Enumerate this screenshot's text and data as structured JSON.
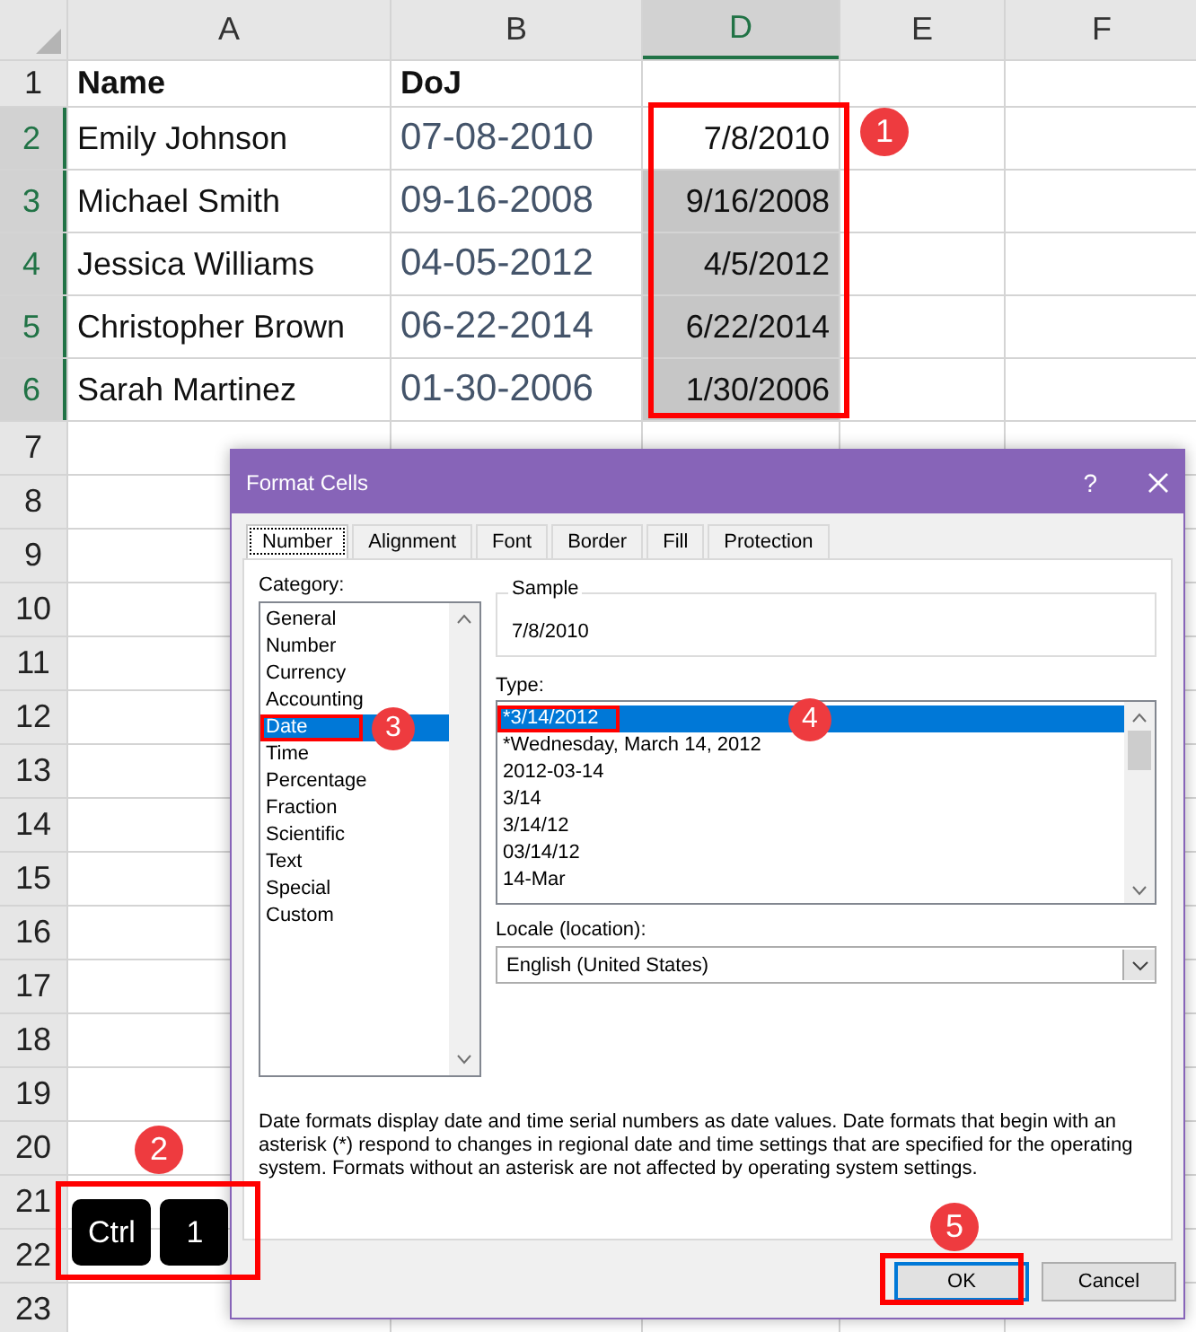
{
  "sheet": {
    "columns": [
      {
        "label": "A",
        "selected": false
      },
      {
        "label": "B",
        "selected": false
      },
      {
        "label": "D",
        "selected": true
      },
      {
        "label": "E",
        "selected": false
      },
      {
        "label": "F",
        "selected": false
      }
    ],
    "rows": [
      {
        "number": "1",
        "kind": "header",
        "selected": false,
        "name": "Name",
        "doj": "DoJ"
      },
      {
        "number": "2",
        "kind": "data",
        "selected": true,
        "active": true,
        "name": "Emily Johnson",
        "doj": "07-08-2010",
        "converted": "7/8/2010"
      },
      {
        "number": "3",
        "kind": "data",
        "selected": true,
        "active": false,
        "name": "Michael Smith",
        "doj": "09-16-2008",
        "converted": "9/16/2008"
      },
      {
        "number": "4",
        "kind": "data",
        "selected": true,
        "active": false,
        "name": "Jessica Williams",
        "doj": "04-05-2012",
        "converted": "4/5/2012"
      },
      {
        "number": "5",
        "kind": "data",
        "selected": true,
        "active": false,
        "name": "Christopher Brown",
        "doj": "06-22-2014",
        "converted": "6/22/2014"
      },
      {
        "number": "6",
        "kind": "data",
        "selected": true,
        "active": false,
        "name": "Sarah Martinez",
        "doj": "01-30-2006",
        "converted": "1/30/2006"
      },
      {
        "number": "7",
        "kind": "empty",
        "selected": false
      },
      {
        "number": "8",
        "kind": "empty",
        "selected": false
      },
      {
        "number": "9",
        "kind": "empty",
        "selected": false
      },
      {
        "number": "10",
        "kind": "empty",
        "selected": false
      },
      {
        "number": "11",
        "kind": "empty",
        "selected": false
      },
      {
        "number": "12",
        "kind": "empty",
        "selected": false
      },
      {
        "number": "13",
        "kind": "empty",
        "selected": false
      },
      {
        "number": "14",
        "kind": "empty",
        "selected": false
      },
      {
        "number": "15",
        "kind": "empty",
        "selected": false
      },
      {
        "number": "16",
        "kind": "empty",
        "selected": false
      },
      {
        "number": "17",
        "kind": "empty",
        "selected": false
      },
      {
        "number": "18",
        "kind": "empty",
        "selected": false
      },
      {
        "number": "19",
        "kind": "empty",
        "selected": false
      },
      {
        "number": "20",
        "kind": "empty",
        "selected": false
      },
      {
        "number": "21",
        "kind": "empty",
        "selected": false
      },
      {
        "number": "22",
        "kind": "empty",
        "selected": false
      },
      {
        "number": "23",
        "kind": "empty",
        "selected": false
      }
    ]
  },
  "dialog": {
    "title": "Format Cells",
    "help": "?",
    "tabs": [
      {
        "label": "Number",
        "selected": true
      },
      {
        "label": "Alignment",
        "selected": false
      },
      {
        "label": "Font",
        "selected": false
      },
      {
        "label": "Border",
        "selected": false
      },
      {
        "label": "Fill",
        "selected": false
      },
      {
        "label": "Protection",
        "selected": false
      }
    ],
    "category_label": "Category:",
    "categories": [
      {
        "label": "General",
        "selected": false
      },
      {
        "label": "Number",
        "selected": false
      },
      {
        "label": "Currency",
        "selected": false
      },
      {
        "label": "Accounting",
        "selected": false
      },
      {
        "label": "Date",
        "selected": true
      },
      {
        "label": "Time",
        "selected": false
      },
      {
        "label": "Percentage",
        "selected": false
      },
      {
        "label": "Fraction",
        "selected": false
      },
      {
        "label": "Scientific",
        "selected": false
      },
      {
        "label": "Text",
        "selected": false
      },
      {
        "label": "Special",
        "selected": false
      },
      {
        "label": "Custom",
        "selected": false
      }
    ],
    "sample_label": "Sample",
    "sample": "7/8/2010",
    "type_label": "Type:",
    "types": [
      {
        "label": "*3/14/2012",
        "selected": true
      },
      {
        "label": "*Wednesday, March 14, 2012",
        "selected": false
      },
      {
        "label": "2012-03-14",
        "selected": false
      },
      {
        "label": "3/14",
        "selected": false
      },
      {
        "label": "3/14/12",
        "selected": false
      },
      {
        "label": "03/14/12",
        "selected": false
      },
      {
        "label": "14-Mar",
        "selected": false
      }
    ],
    "locale_label": "Locale (location):",
    "locale": "English (United States)",
    "description": "Date formats display date and time serial numbers as date values.  Date formats that begin with an asterisk (*) respond to changes in regional date and time settings that are specified for the operating system. Formats without an asterisk are not affected by operating system settings.",
    "buttons": [
      {
        "label": "OK",
        "kind": "default"
      },
      {
        "label": "Cancel",
        "kind": "normal"
      }
    ]
  },
  "keys": [
    "Ctrl",
    "1"
  ],
  "callouts": [
    "1",
    "2",
    "3",
    "4",
    "5"
  ]
}
